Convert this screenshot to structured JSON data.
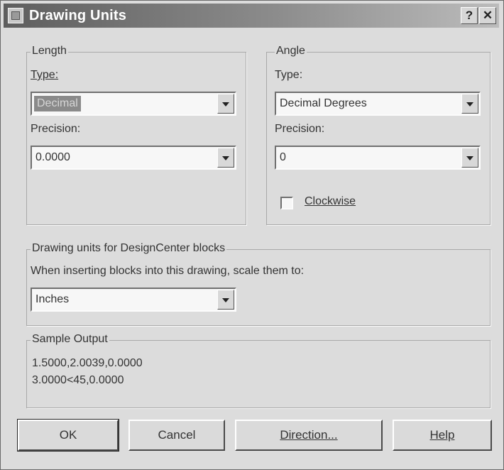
{
  "title": "Drawing Units",
  "title_buttons": {
    "help": "?",
    "close": "✕"
  },
  "length": {
    "group_label": "Length",
    "type_label": "Type:",
    "type_value": "Decimal",
    "precision_label": "Precision:",
    "precision_value": "0.0000"
  },
  "angle": {
    "group_label": "Angle",
    "type_label": "Type:",
    "type_value": "Decimal Degrees",
    "precision_label": "Precision:",
    "precision_value": "0",
    "clockwise_label": "Clockwise",
    "clockwise_checked": false
  },
  "designcenter": {
    "group_label": "Drawing units for DesignCenter blocks",
    "prompt": "When inserting blocks into this drawing, scale them to:",
    "units_value": "Inches"
  },
  "sample": {
    "group_label": "Sample Output",
    "lines": [
      "1.5000,2.0039,0.0000",
      "3.0000<45,0.0000"
    ]
  },
  "buttons": {
    "ok": "OK",
    "cancel": "Cancel",
    "direction": "Direction...",
    "help": "Help"
  },
  "icons": {
    "app": "autocad-dialog-icon",
    "dropdown": "chevron-down-icon",
    "help": "question-mark-icon",
    "close": "close-icon"
  }
}
